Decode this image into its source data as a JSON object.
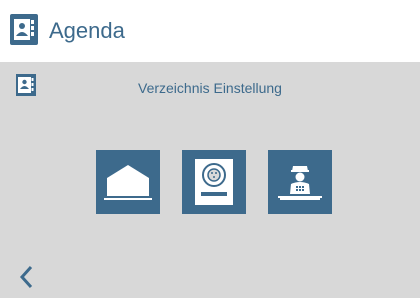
{
  "header": {
    "title": "Agenda",
    "icon": "address-book-icon"
  },
  "panel": {
    "icon": "address-book-icon",
    "title": "Verzeichnis Einstellung",
    "tiles": [
      {
        "icon": "home-icon"
      },
      {
        "icon": "door-station-icon"
      },
      {
        "icon": "concierge-icon"
      }
    ],
    "back_icon": "chevron-left-icon"
  },
  "colors": {
    "accent": "#3d6a8c",
    "panel_bg": "#d8d8d8",
    "page_bg": "#ffffff"
  }
}
